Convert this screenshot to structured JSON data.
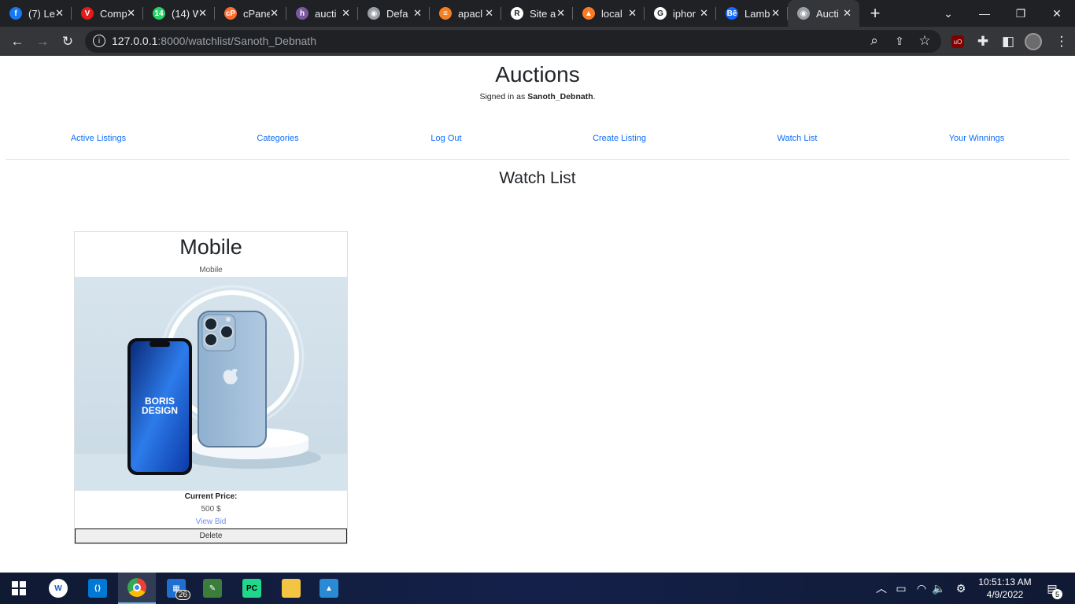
{
  "browser": {
    "tabs": [
      {
        "title": "(7) Le",
        "icon": "facebook-icon",
        "color": "#1877f2",
        "glyph": "f"
      },
      {
        "title": "Comp",
        "icon": "v-logo-icon",
        "color": "#e21b1b",
        "glyph": "V"
      },
      {
        "title": "(14) W",
        "icon": "whatsapp-icon",
        "color": "#25d366",
        "glyph": "14"
      },
      {
        "title": "cPane",
        "icon": "cpanel-icon",
        "color": "#ff6c2c",
        "glyph": "cP"
      },
      {
        "title": "aucti",
        "icon": "heroku-icon",
        "color": "#79589f",
        "glyph": "h"
      },
      {
        "title": "Defa",
        "icon": "globe-icon",
        "color": "#9aa0a6",
        "glyph": "◉"
      },
      {
        "title": "apacl",
        "icon": "stackoverflow-icon",
        "color": "#f48024",
        "glyph": "≡"
      },
      {
        "title": "Site a",
        "icon": "site-icon",
        "color": "#ffffff",
        "glyph": "R"
      },
      {
        "title": "local",
        "icon": "xampp-icon",
        "color": "#fb7a24",
        "glyph": "▲"
      },
      {
        "title": "iphor",
        "icon": "google-icon",
        "color": "#ffffff",
        "glyph": "G"
      },
      {
        "title": "Lamb",
        "icon": "behance-icon",
        "color": "#1769ff",
        "glyph": "Bē"
      },
      {
        "title": "Aucti",
        "icon": "globe-icon",
        "color": "#9aa0a6",
        "glyph": "◉"
      }
    ],
    "url_host": "127.0.0.1",
    "url_rest": ":8000/watchlist/Sanoth_Debnath"
  },
  "site": {
    "title": "Auctions",
    "signed_in_prefix": "Signed in as ",
    "username": "Sanoth_Debnath",
    "signed_in_suffix": ".",
    "nav": [
      "Active Listings",
      "Categories",
      "Log Out",
      "Create Listing",
      "Watch List",
      "Your Winnings"
    ],
    "page_heading": "Watch List"
  },
  "listing": {
    "title": "Mobile",
    "category": "Mobile",
    "image_brand_line1": "BORIS",
    "image_brand_line2": "DESIGN",
    "price_label": "Current Price:",
    "price_value": "500 $",
    "view_bid": "View Bid",
    "delete": "Delete"
  },
  "taskbar": {
    "store_badge": "26",
    "time": "10:51:13 AM",
    "date": "4/9/2022",
    "notification_count": "5"
  }
}
